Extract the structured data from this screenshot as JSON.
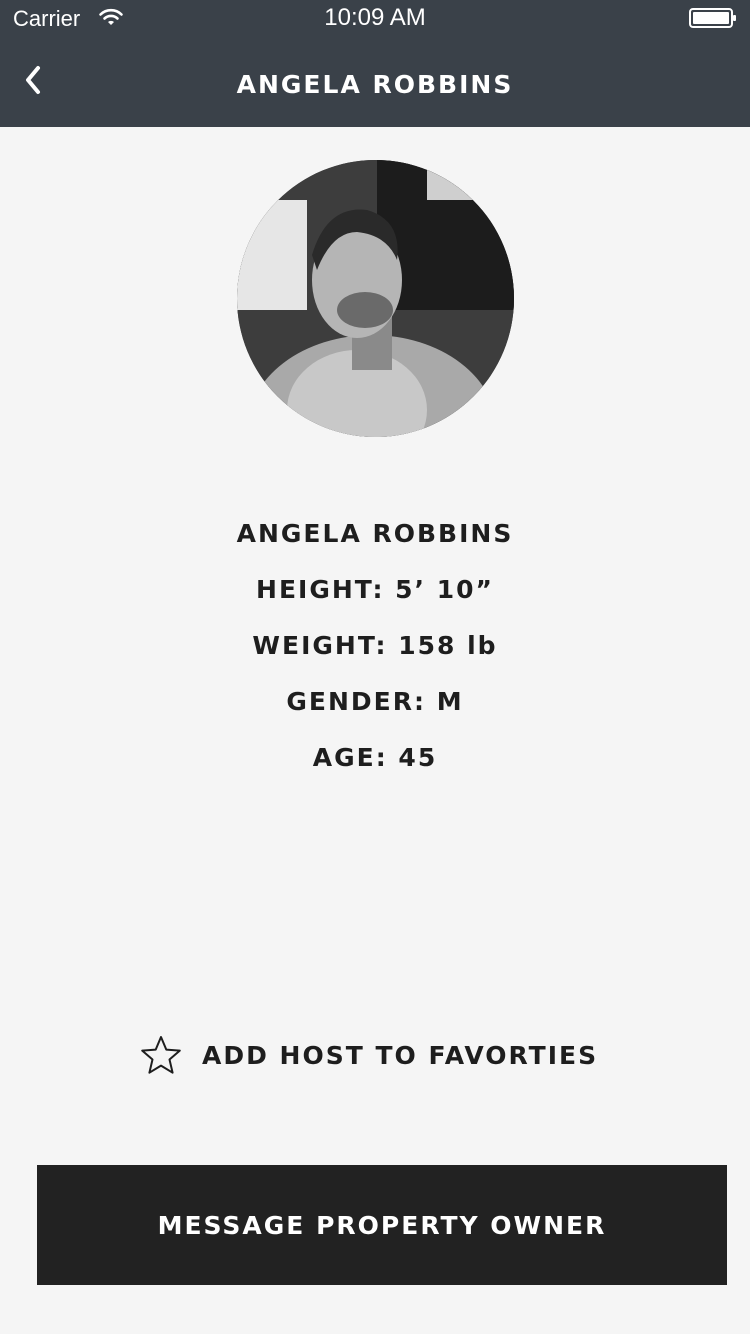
{
  "status_bar": {
    "carrier": "Carrier",
    "time": "10:09 AM",
    "wifi_icon": "wifi-icon",
    "battery_icon": "battery-icon"
  },
  "nav": {
    "back_icon": "chevron-left-icon",
    "title": "ANGELA ROBBINS"
  },
  "profile": {
    "avatar": "profile-photo",
    "name": "ANGELA ROBBINS",
    "height": "HEIGHT: 5’ 10”",
    "weight": "WEIGHT: 158 lb",
    "gender": "GENDER: M",
    "age": "AGE: 45"
  },
  "actions": {
    "favorite_icon": "star-icon",
    "favorite_label": "ADD HOST TO FAVORTIES",
    "message_label": "MESSAGE PROPERTY OWNER"
  },
  "colors": {
    "header_bg": "#3a4149",
    "page_bg": "#f5f5f5",
    "button_bg": "#222222",
    "text": "#1e1e1e"
  }
}
